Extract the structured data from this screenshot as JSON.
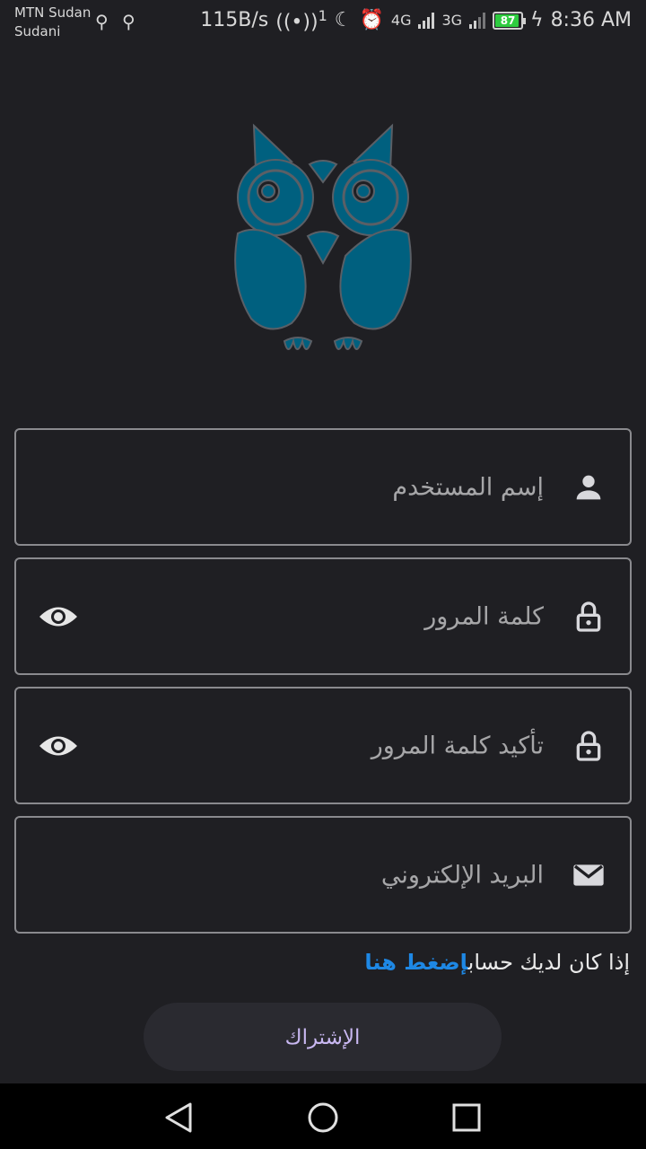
{
  "status": {
    "carrier_line1": "MTN Sudan",
    "carrier_line2": "Sudani",
    "speed": "115B/s",
    "hotspot_sup": "1",
    "net1": "4G",
    "net2": "3G",
    "battery": "87",
    "time": "8:36 AM"
  },
  "form": {
    "username_label": "إسم المستخدم",
    "password_label": "كلمة المرور",
    "confirm_password_label": "تأكيد كلمة المرور",
    "email_label": "البريد الإلكتروني",
    "have_account_text": "إذا كان لديك حساب",
    "login_link": "إضغط هنا",
    "signup_button": "الإشتراك"
  },
  "colors": {
    "background": "#1f1f23",
    "owl": "#00607f",
    "link": "#1e88e5",
    "button_text": "#c9b8f2"
  },
  "icons": {
    "username": "person-icon",
    "password": "lock-icon",
    "confirm_password": "lock-icon",
    "email": "mail-icon",
    "visibility": "eye-icon"
  }
}
